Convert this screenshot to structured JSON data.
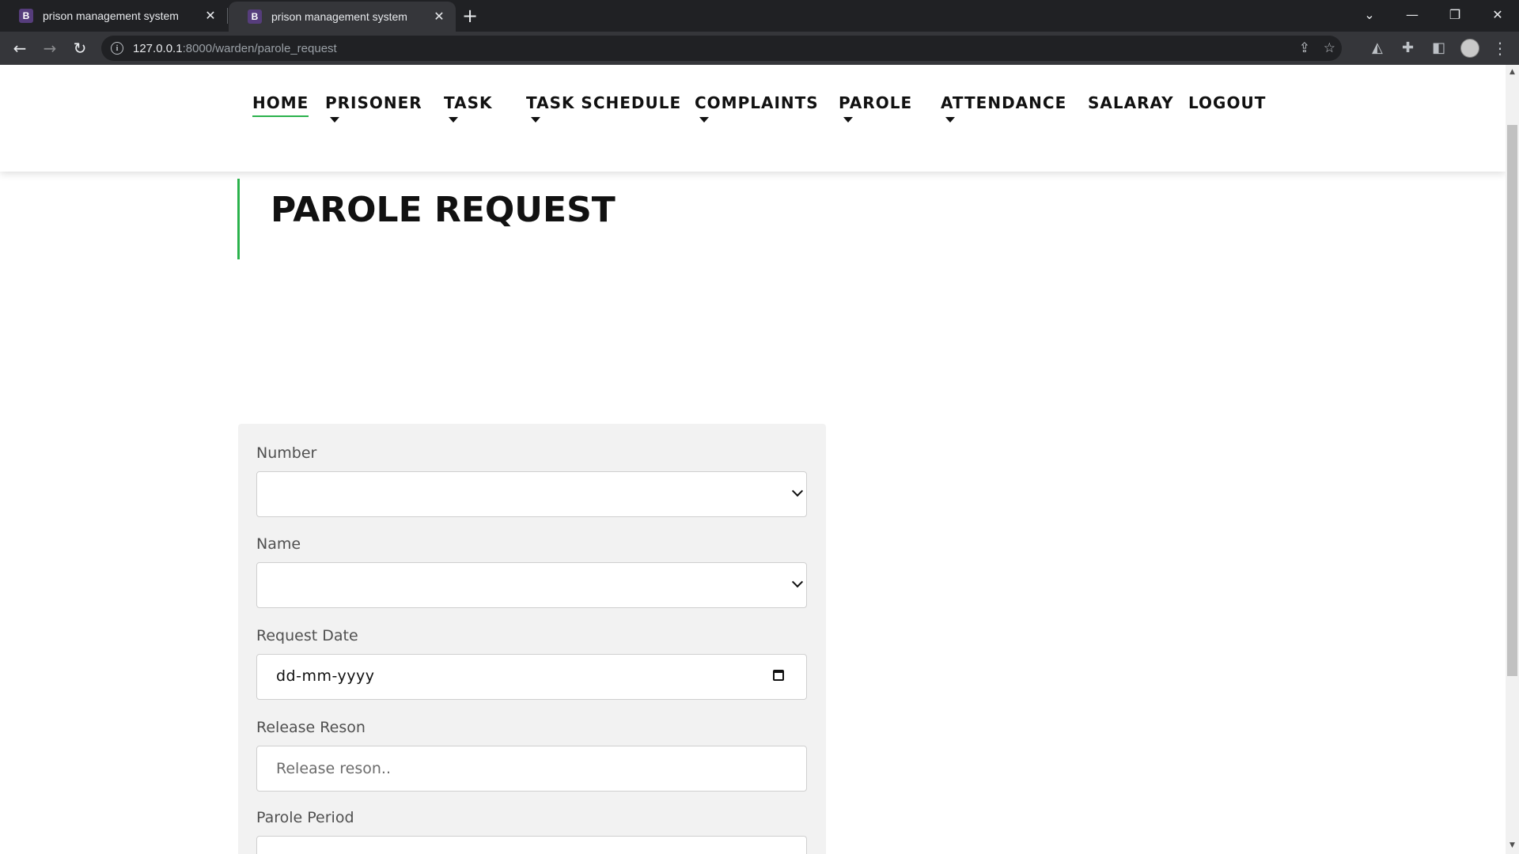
{
  "browser": {
    "tabs": [
      {
        "title": "prison management system",
        "favicon": "B"
      },
      {
        "title": "prison management system",
        "favicon": "B"
      }
    ],
    "url_host": "127.0.0.1",
    "url_path": ":8000/warden/parole_request"
  },
  "nav": {
    "items": [
      {
        "label": "HOME",
        "active": true,
        "dropdown": false
      },
      {
        "label": "PRISONER",
        "dropdown": true
      },
      {
        "label": "TASK",
        "dropdown": true
      },
      {
        "label": "TASK SCHEDULE",
        "dropdown": true
      },
      {
        "label": "COMPLAINTS",
        "dropdown": true
      },
      {
        "label": "PAROLE",
        "dropdown": true
      },
      {
        "label": "ATTENDANCE",
        "dropdown": true
      },
      {
        "label": "SALARAY",
        "dropdown": false
      },
      {
        "label": "LOGOUT",
        "dropdown": false
      }
    ],
    "accent_color": "#2bb24c"
  },
  "page": {
    "title": "PAROLE REQUEST"
  },
  "form": {
    "fields": [
      {
        "label": "Number",
        "type": "select",
        "value": ""
      },
      {
        "label": "Name",
        "type": "select",
        "value": ""
      },
      {
        "label": "Request Date",
        "type": "date",
        "value": "dd-mm-yyyy"
      },
      {
        "label": "Release Reson",
        "type": "text",
        "placeholder": "Release reson.."
      },
      {
        "label": "Parole Period",
        "type": "text",
        "placeholder": ""
      }
    ]
  }
}
